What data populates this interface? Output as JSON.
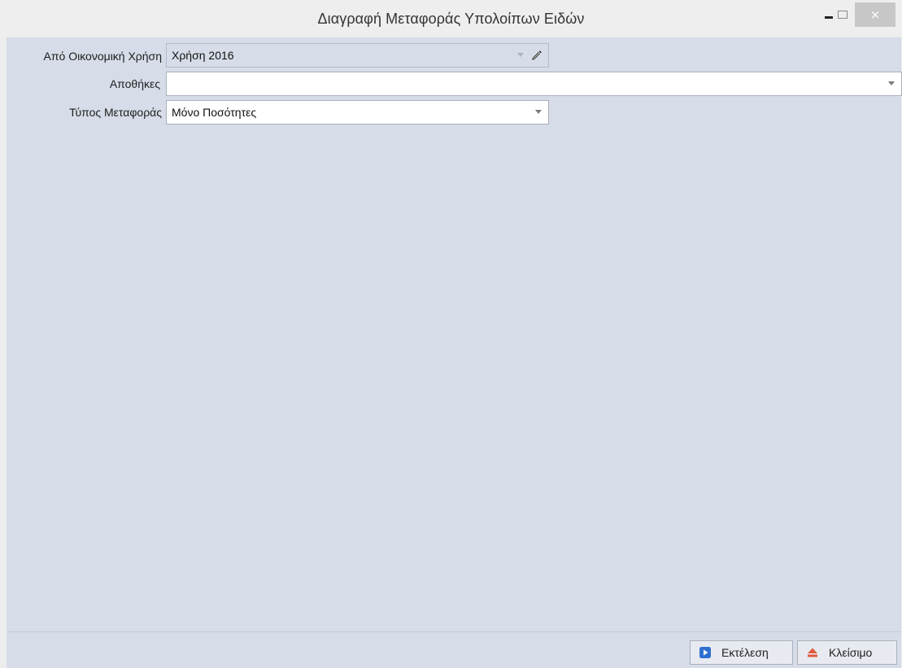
{
  "window": {
    "title": "Διαγραφή Μεταφοράς Υπολοίπων Ειδών",
    "close_glyph": "×"
  },
  "form": {
    "fiscal_year": {
      "label": "Από Οικονομική Χρήση",
      "value": "Χρήση 2016",
      "disabled": true
    },
    "warehouses": {
      "label": "Αποθήκες",
      "value": ""
    },
    "transfer_type": {
      "label": "Τύπος Μεταφοράς",
      "value": "Μόνο Ποσότητες"
    }
  },
  "footer": {
    "execute_label": "Εκτέλεση",
    "close_label": "Κλείσιμο"
  },
  "icons": {
    "execute": "play-icon",
    "close": "eject-icon",
    "edit": "pencil-icon"
  },
  "colors": {
    "panel": "#d6dce8",
    "execute_icon": "#2f6fd0",
    "close_icon": "#e05a3c"
  }
}
